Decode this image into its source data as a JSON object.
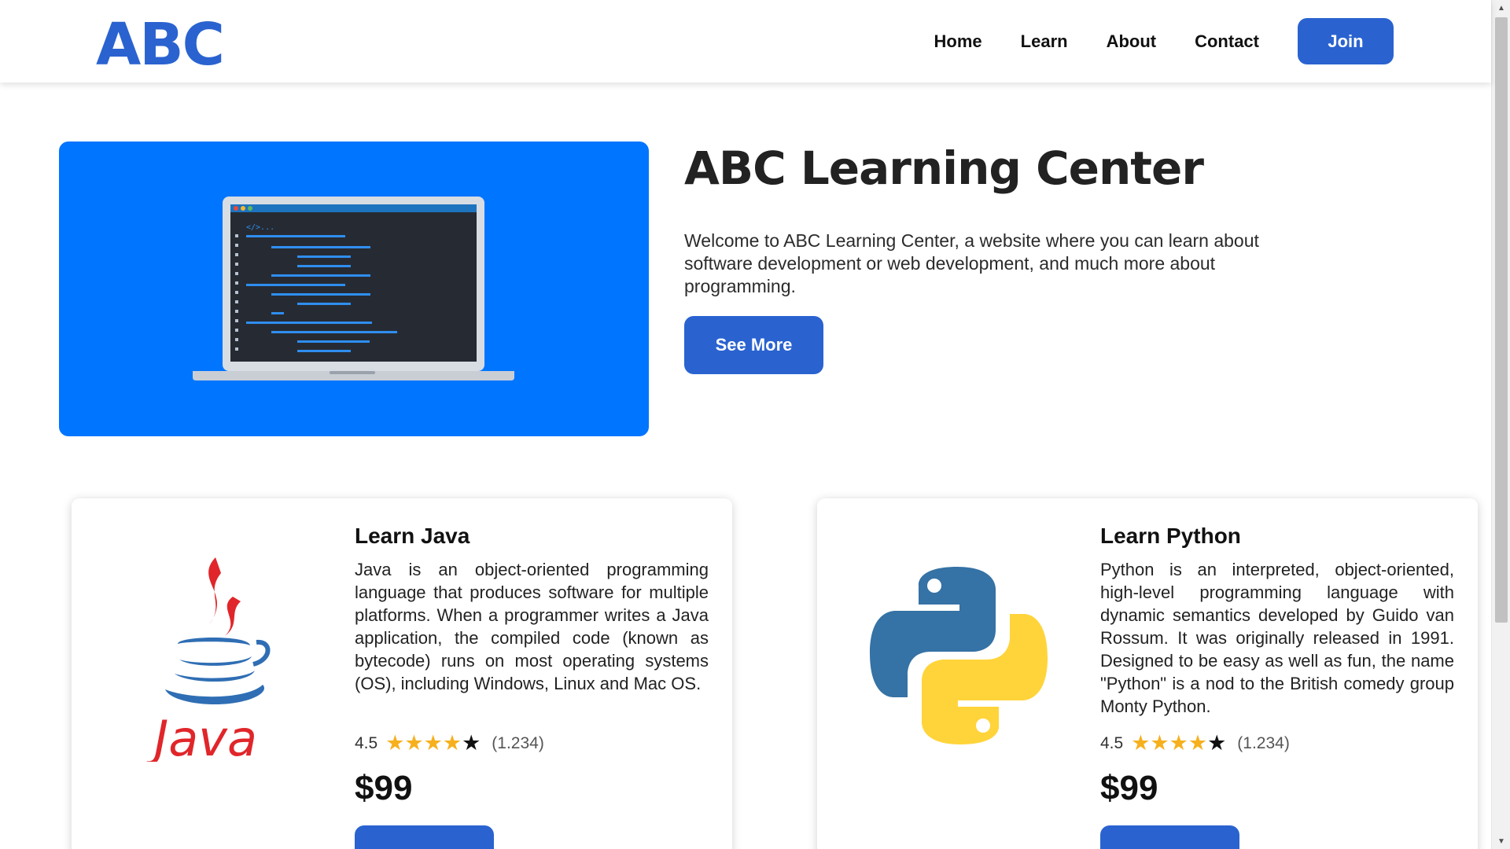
{
  "header": {
    "logo": "ABC",
    "nav": [
      "Home",
      "Learn",
      "About",
      "Contact"
    ],
    "join_label": "Join"
  },
  "hero": {
    "code_tag": "</>...",
    "title": "ABC Learning Center",
    "description": "Welcome to ABC Learning Center, a website where you can learn about software development or web development, and much more about programming.",
    "button_label": "See More"
  },
  "courses": [
    {
      "title": "Learn Java",
      "logo_text": "Java",
      "description": "Java is an object-oriented programming language that produces software for multiple platforms. When a programmer writes a Java application, the compiled code (known as bytecode) runs on most operating systems (OS), including Windows, Linux and Mac OS.",
      "rating": "4.5",
      "rating_count": "(1.234)",
      "price": "$99"
    },
    {
      "title": "Learn Python",
      "description": "Python is an interpreted, object-oriented, high-level programming language with dynamic semantics developed by Guido van Rossum. It was originally released in 1991. Designed to be easy as well as fun, the name \"Python\" is a nod to the British comedy group Monty Python.",
      "rating": "4.5",
      "rating_count": "(1.234)",
      "price": "$99"
    }
  ],
  "colors": {
    "brand_blue": "#2a63d0",
    "hero_blue": "#0075ff",
    "star": "#f6b01e"
  }
}
